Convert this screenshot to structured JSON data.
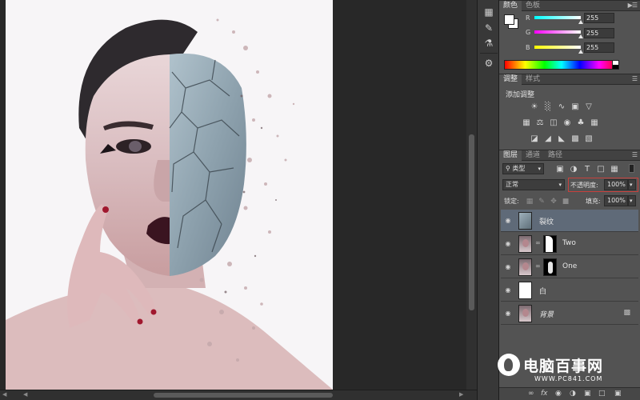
{
  "color_panel": {
    "tabs": [
      "颜色",
      "色板"
    ],
    "channels": [
      {
        "label": "R",
        "value": "255",
        "color": "#ff3b3b"
      },
      {
        "label": "G",
        "value": "255",
        "color": "#3be63b"
      },
      {
        "label": "B",
        "value": "255",
        "color": "#3b6bff"
      }
    ],
    "foreground": "#ffffff",
    "background": "#ffffff"
  },
  "adjustments_panel": {
    "tabs": [
      "调整",
      "样式"
    ],
    "title": "添加调整",
    "icons": [
      "brightness-contrast-icon",
      "levels-icon",
      "curves-icon",
      "exposure-icon",
      "vibrance-icon",
      "hue-saturation-icon",
      "color-balance-icon",
      "black-white-icon",
      "photo-filter-icon",
      "channel-mixer-icon",
      "color-lookup-icon",
      "invert-icon",
      "posterize-icon",
      "threshold-icon",
      "gradient-map-icon",
      "selective-color-icon"
    ]
  },
  "layers_panel": {
    "tabs": [
      "图层",
      "通道",
      "路径"
    ],
    "filter_kind": "类型",
    "blend_mode": "正常",
    "opacity_label": "不透明度:",
    "opacity_value": "100%",
    "lock_label": "锁定:",
    "fill_label": "填充:",
    "fill_value": "100%",
    "layers": [
      {
        "name": "裂纹",
        "visible": true,
        "selected": true
      },
      {
        "name": "Two",
        "visible": true,
        "selected": false
      },
      {
        "name": "One",
        "visible": true,
        "selected": false
      },
      {
        "name": "白",
        "visible": true,
        "selected": false
      },
      {
        "name": "背景",
        "visible": true,
        "selected": false,
        "locked": true
      }
    ],
    "footer_icons": [
      "link-layers-icon",
      "fx-icon",
      "add-mask-icon",
      "adjustment-layer-icon",
      "new-group-icon",
      "new-layer-icon",
      "delete-layer-icon"
    ]
  },
  "watermark": {
    "title": "电脑百事网",
    "url": "WWW.PC841.COM"
  },
  "tool_strip": {
    "icons": [
      "history-icon",
      "brush-presets-icon",
      "clone-source-icon",
      "tool-presets-icon",
      "navigator-icon"
    ]
  }
}
